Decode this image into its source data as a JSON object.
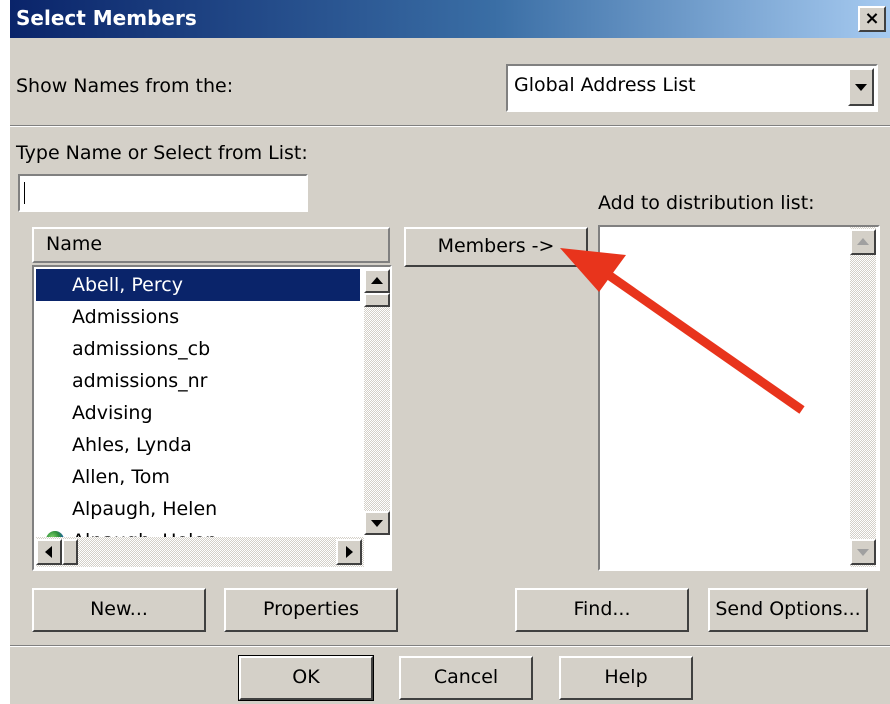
{
  "dialog": {
    "title": "Select Members",
    "close_label": "×"
  },
  "show_names": {
    "label": "Show Names from the:",
    "selected": "Global Address List"
  },
  "type_name": {
    "label": "Type Name or Select from List:",
    "value": ""
  },
  "names_list": {
    "header": "Name",
    "items": [
      {
        "label": "Abell, Percy",
        "selected": true
      },
      {
        "label": "Admissions"
      },
      {
        "label": "admissions_cb"
      },
      {
        "label": "admissions_nr"
      },
      {
        "label": "Advising"
      },
      {
        "label": "Ahles, Lynda"
      },
      {
        "label": "Allen, Tom"
      },
      {
        "label": "Alpaugh, Helen"
      },
      {
        "label": "Alpaugh, Helen",
        "icon": "globe-icon"
      }
    ]
  },
  "members_button": "Members ->",
  "distribution": {
    "label": "Add to distribution list:"
  },
  "buttons": {
    "new": "New...",
    "properties": "Properties",
    "find": "Find...",
    "send_options": "Send Options...",
    "ok": "OK",
    "cancel": "Cancel",
    "help": "Help"
  },
  "annotation": {
    "icon": "red-arrow-icon",
    "color": "#e8341c"
  },
  "colors": {
    "title_start": "#0a246a",
    "title_end": "#a6caf0",
    "selection": "#0a246a",
    "face": "#d4d0c8"
  }
}
